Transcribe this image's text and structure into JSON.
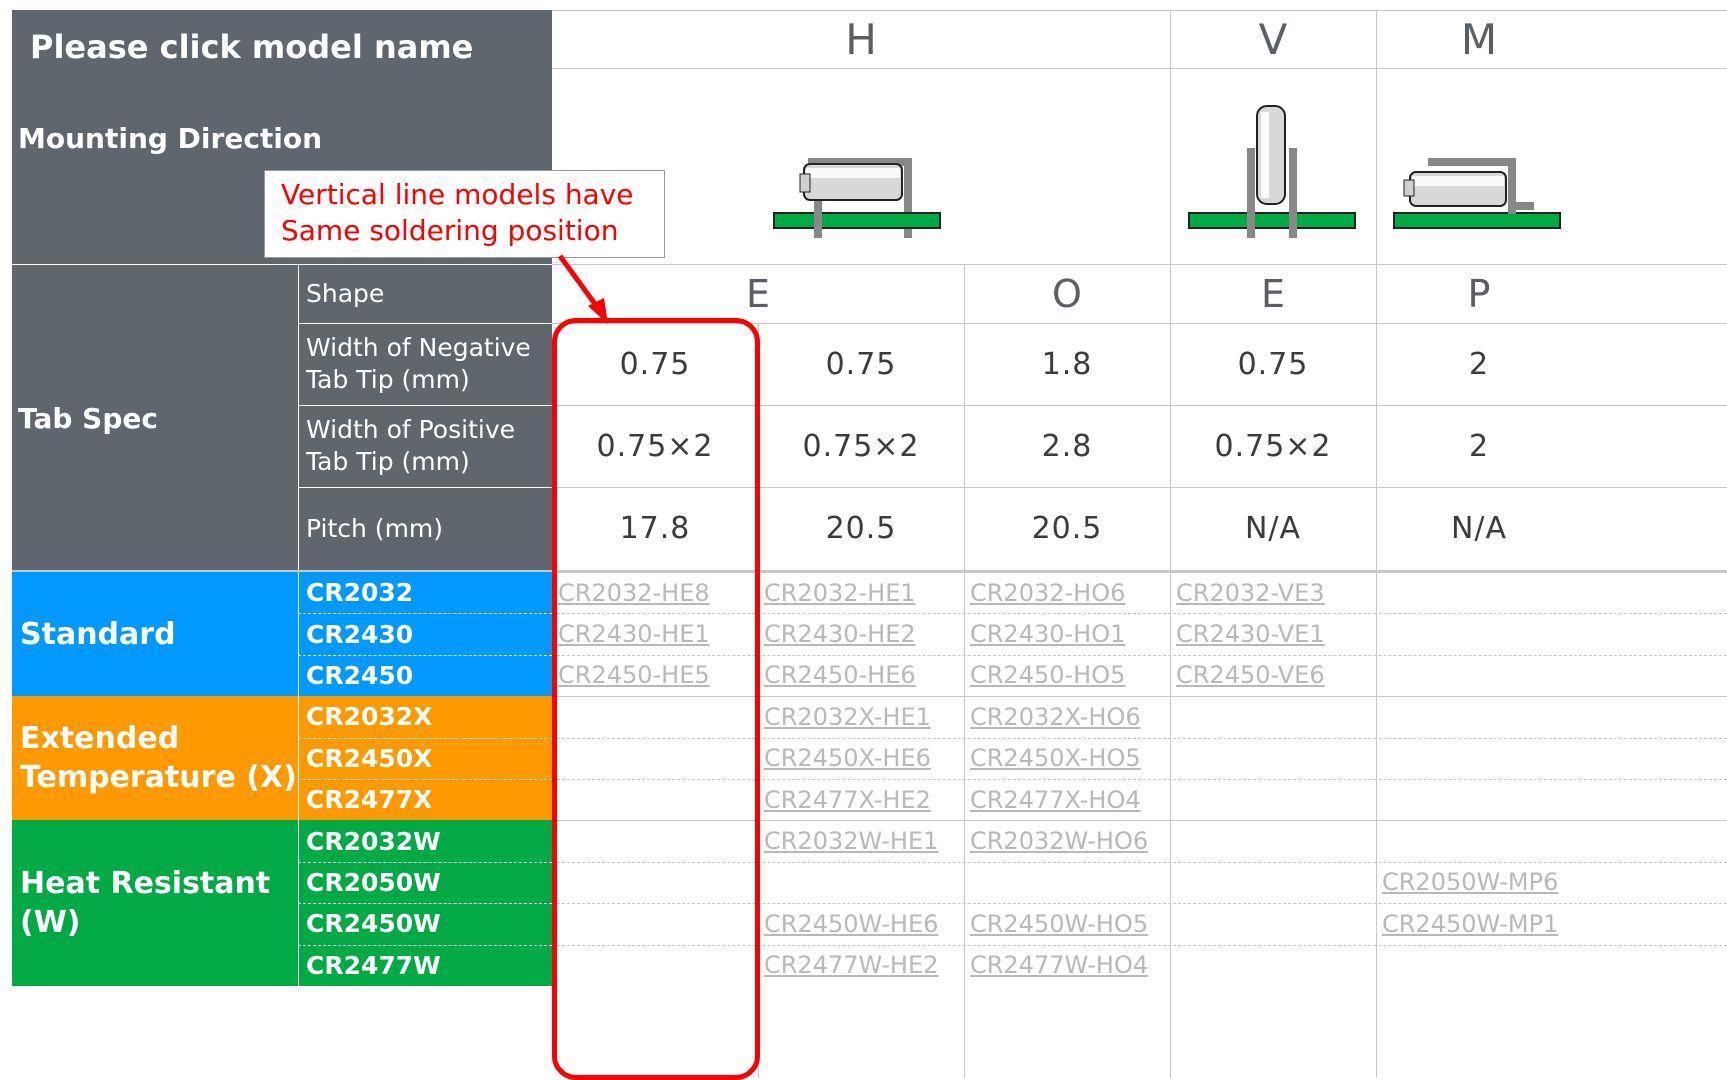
{
  "table": {
    "corner_title": "Please click model name",
    "mounting_direction_label": "Mounting Direction",
    "tab_spec_label": "Tab Spec",
    "directions": [
      "H",
      "V",
      "M"
    ],
    "spec_labels": {
      "shape": "Shape",
      "neg_width": "Width of Negative Tab Tip (mm)",
      "pos_width": "Width of Positive Tab Tip (mm)",
      "pitch": "Pitch (mm)"
    },
    "shapes": [
      "E",
      "O",
      "E",
      "P"
    ],
    "neg_width": [
      "0.75",
      "0.75",
      "1.8",
      "0.75",
      "2"
    ],
    "pos_width": [
      "0.75×2",
      "0.75×2",
      "2.8",
      "0.75×2",
      "2"
    ],
    "pitch": [
      "17.8",
      "20.5",
      "20.5",
      "N/A",
      "N/A"
    ],
    "groups": [
      {
        "label": "Standard",
        "color": "#0099ff",
        "rows": [
          {
            "model": "CR2032",
            "links": [
              "CR2032-HE8",
              "CR2032-HE1",
              "CR2032-HO6",
              "CR2032-VE3",
              ""
            ]
          },
          {
            "model": "CR2430",
            "links": [
              "CR2430-HE1",
              "CR2430-HE2",
              "CR2430-HO1",
              "CR2430-VE1",
              ""
            ]
          },
          {
            "model": "CR2450",
            "links": [
              "CR2450-HE5",
              "CR2450-HE6",
              "CR2450-HO5",
              "CR2450-VE6",
              ""
            ]
          }
        ]
      },
      {
        "label": "Extended Temperature (X)",
        "color": "#ff9900",
        "rows": [
          {
            "model": "CR2032X",
            "links": [
              "",
              "CR2032X-HE1",
              "CR2032X-HO6",
              "",
              ""
            ]
          },
          {
            "model": "CR2450X",
            "links": [
              "",
              "CR2450X-HE6",
              "CR2450X-HO5",
              "",
              ""
            ]
          },
          {
            "model": "CR2477X",
            "links": [
              "",
              "CR2477X-HE2",
              "CR2477X-HO4",
              "",
              ""
            ]
          }
        ]
      },
      {
        "label": "Heat Resistant (W)",
        "color": "#00aa44",
        "rows": [
          {
            "model": "CR2032W",
            "links": [
              "",
              "CR2032W-HE1",
              "CR2032W-HO6",
              "",
              ""
            ]
          },
          {
            "model": "CR2050W",
            "links": [
              "",
              "",
              "",
              "",
              "CR2050W-MP6"
            ]
          },
          {
            "model": "CR2450W",
            "links": [
              "",
              "CR2450W-HE6",
              "CR2450W-HO5",
              "",
              "CR2450W-MP1"
            ]
          },
          {
            "model": "CR2477W",
            "links": [
              "",
              "CR2477W-HE2",
              "CR2477W-HO4",
              "",
              ""
            ]
          }
        ]
      }
    ]
  },
  "callout": {
    "text": "Vertical line models have Same soldering position",
    "color": "#ff0000"
  },
  "icons": [
    "horizontal-mount-icon",
    "vertical-mount-icon",
    "m-mount-icon"
  ],
  "colors": {
    "header_gray": "#5f666d",
    "pcb_green": "#00aa44",
    "highlight_red": "#ff0000",
    "link_gray": "#b9b9b9"
  }
}
